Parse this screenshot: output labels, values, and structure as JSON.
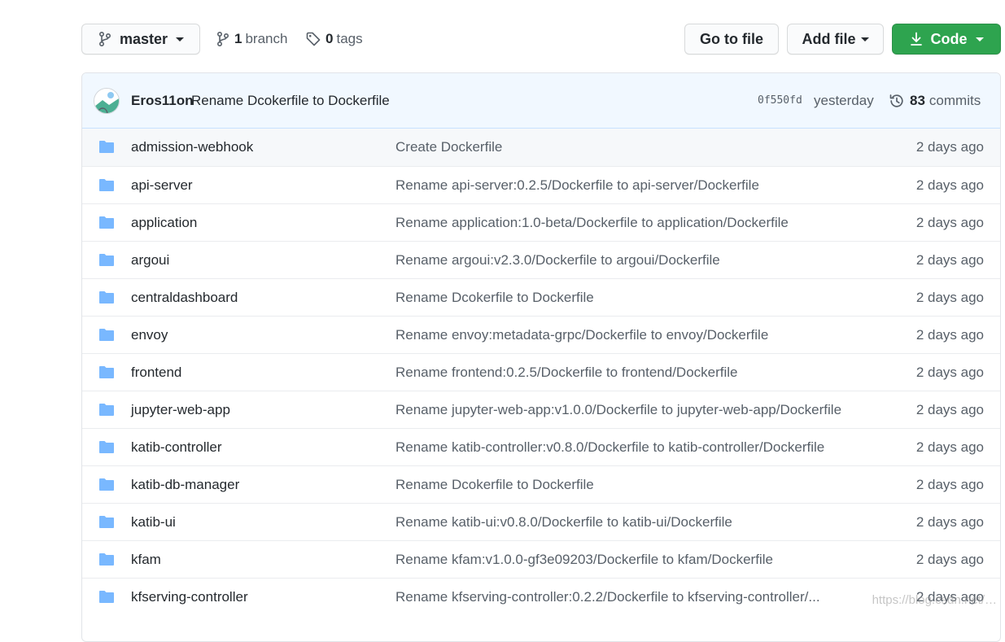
{
  "toolbar": {
    "branch_button": "master",
    "branches_count": "1",
    "branches_label": "branch",
    "tags_count": "0",
    "tags_label": "tags",
    "go_to_file": "Go to file",
    "add_file": "Add file",
    "code": "Code"
  },
  "latest_commit": {
    "author": "Eros11on",
    "message": "Rename Dcokerfile to Dockerfile",
    "sha": "0f550fd",
    "time": "yesterday",
    "commits_count": "83",
    "commits_label": "commits"
  },
  "files": [
    {
      "name": "admission-webhook",
      "message": "Create Dockerfile",
      "age": "2 days ago"
    },
    {
      "name": "api-server",
      "message": "Rename api-server:0.2.5/Dockerfile to api-server/Dockerfile",
      "age": "2 days ago"
    },
    {
      "name": "application",
      "message": "Rename application:1.0-beta/Dockerfile to application/Dockerfile",
      "age": "2 days ago"
    },
    {
      "name": "argoui",
      "message": "Rename argoui:v2.3.0/Dockerfile to argoui/Dockerfile",
      "age": "2 days ago"
    },
    {
      "name": "centraldashboard",
      "message": "Rename Dcokerfile to Dockerfile",
      "age": "2 days ago"
    },
    {
      "name": "envoy",
      "message": "Rename envoy:metadata-grpc/Dockerfile to envoy/Dockerfile",
      "age": "2 days ago"
    },
    {
      "name": "frontend",
      "message": "Rename frontend:0.2.5/Dockerfile to frontend/Dockerfile",
      "age": "2 days ago"
    },
    {
      "name": "jupyter-web-app",
      "message": "Rename jupyter-web-app:v1.0.0/Dockerfile to jupyter-web-app/Dockerfile",
      "age": "2 days ago"
    },
    {
      "name": "katib-controller",
      "message": "Rename katib-controller:v0.8.0/Dockerfile to katib-controller/Dockerfile",
      "age": "2 days ago"
    },
    {
      "name": "katib-db-manager",
      "message": "Rename Dcokerfile to Dockerfile",
      "age": "2 days ago"
    },
    {
      "name": "katib-ui",
      "message": "Rename katib-ui:v0.8.0/Dockerfile to katib-ui/Dockerfile",
      "age": "2 days ago"
    },
    {
      "name": "kfam",
      "message": "Rename kfam:v1.0.0-gf3e09203/Dockerfile to kfam/Dockerfile",
      "age": "2 days ago"
    },
    {
      "name": "kfserving-controller",
      "message": "Rename kfserving-controller:0.2.2/Dockerfile to kfserving-controller/...",
      "age": "2 days ago"
    }
  ],
  "watermark": "https://blog.csdn.net/…"
}
